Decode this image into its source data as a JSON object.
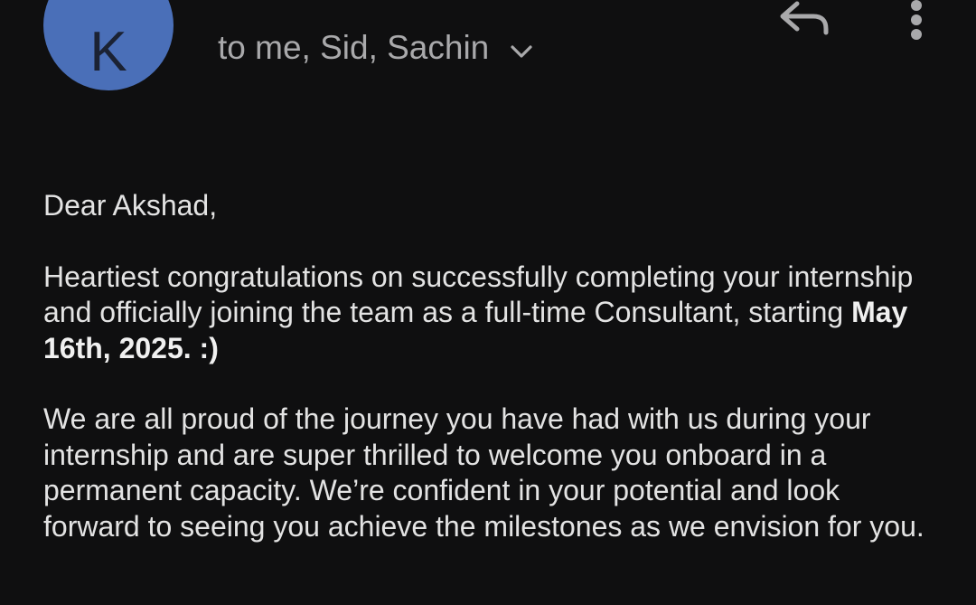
{
  "sender": {
    "avatar_letter": "K",
    "avatar_color": "#4a6fb8"
  },
  "recipients": {
    "text": "to me, Sid, Sachin"
  },
  "icons": {
    "reply": "reply-icon",
    "more": "more-vert-icon",
    "expand": "chevron-down-icon"
  },
  "message": {
    "greeting": "Dear Akshad,",
    "para1_text": "Heartiest congratulations on successfully completing your internship and officially joining the team as a full-time Consultant, starting ",
    "para1_bold": "May 16th, 2025. :)",
    "para2": "We are all proud of the journey you have had with us during your internship and are super thrilled to welcome you onboard in a permanent capacity. We’re confident in your potential and look forward to seeing you achieve the milestones as we envision for you."
  }
}
